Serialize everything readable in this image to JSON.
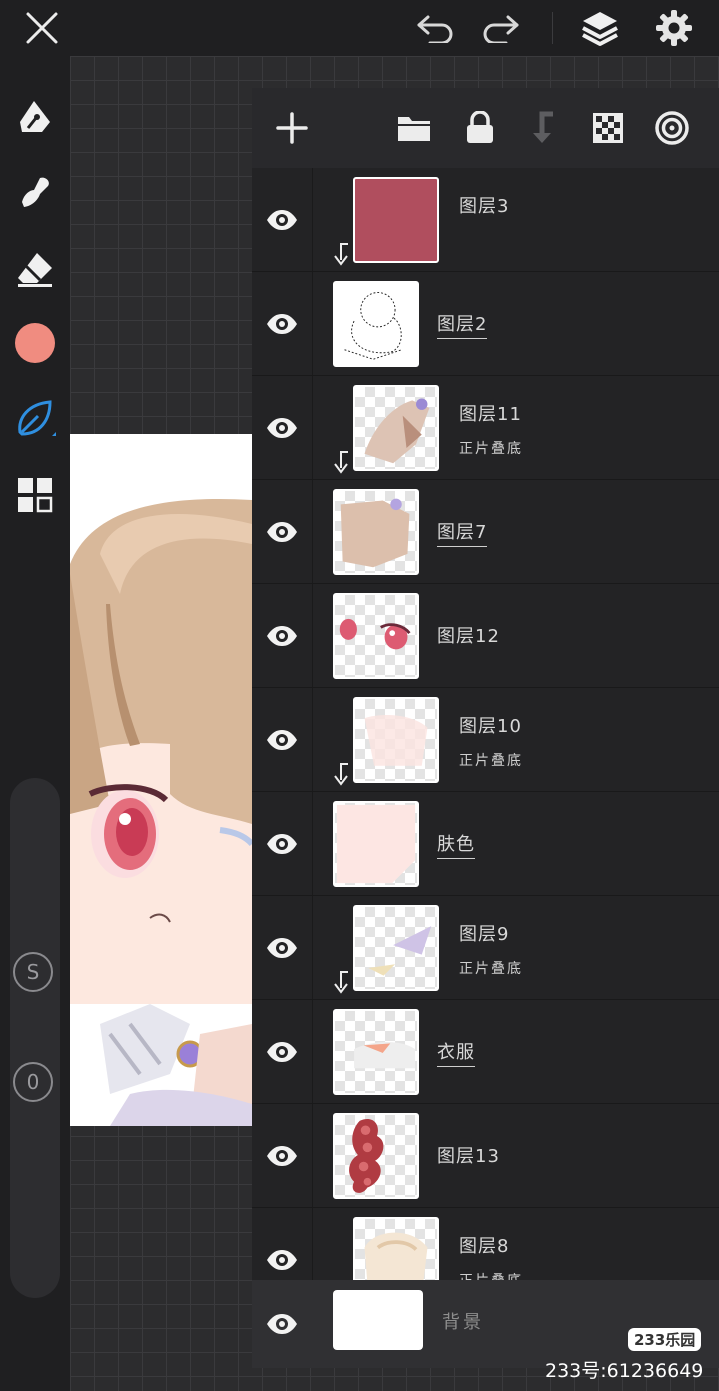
{
  "topbar": {
    "close_icon": "close-icon",
    "undo_icon": "undo-icon",
    "redo_icon": "redo-icon",
    "layers_icon": "layers-icon",
    "settings_icon": "gear-icon"
  },
  "toolbar": {
    "tools": [
      "pen-icon",
      "smudge-icon",
      "eraser-icon",
      "color-swatch",
      "brush-leaf-icon",
      "grid-icon"
    ],
    "current_color": "#f08c80",
    "active_color": "#2f8fe0",
    "size_label": "S",
    "opacity_label": "0"
  },
  "layer_panel": {
    "layers": [
      {
        "name": "图层3",
        "blend": "",
        "clipped": true,
        "underline": false,
        "visible": true
      },
      {
        "name": "图层2",
        "blend": "",
        "clipped": false,
        "underline": true,
        "visible": true
      },
      {
        "name": "图层11",
        "blend": "正片叠底",
        "clipped": true,
        "underline": false,
        "visible": true
      },
      {
        "name": "图层7",
        "blend": "",
        "clipped": false,
        "underline": true,
        "visible": true
      },
      {
        "name": "图层12",
        "blend": "",
        "clipped": false,
        "underline": false,
        "visible": true
      },
      {
        "name": "图层10",
        "blend": "正片叠底",
        "clipped": true,
        "underline": false,
        "visible": true
      },
      {
        "name": "肤色",
        "blend": "",
        "clipped": false,
        "underline": true,
        "visible": true
      },
      {
        "name": "图层9",
        "blend": "正片叠底",
        "clipped": true,
        "underline": false,
        "visible": true
      },
      {
        "name": "衣服",
        "blend": "",
        "clipped": false,
        "underline": true,
        "visible": true
      },
      {
        "name": "图层13",
        "blend": "",
        "clipped": false,
        "underline": false,
        "visible": true
      },
      {
        "name": "图层8",
        "blend": "正片叠底",
        "clipped": true,
        "underline": false,
        "visible": true
      }
    ],
    "background_layer": {
      "name": "背景",
      "visible": true
    }
  },
  "watermark": {
    "badge": "233乐园",
    "id_text": "233号:61236649"
  }
}
